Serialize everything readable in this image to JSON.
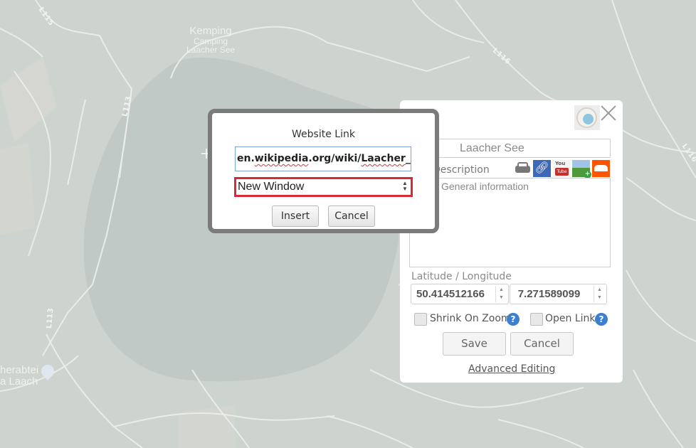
{
  "map": {
    "place_labels": [
      {
        "id": "kemping",
        "lines": [
          "Kemping",
          "Camping",
          "Laacher See"
        ]
      },
      {
        "id": "abbey",
        "lines": [
          "herabtei",
          "a Laach"
        ]
      }
    ],
    "road_labels": [
      "L115",
      "L113",
      "L113",
      "L116",
      "L116"
    ],
    "poi_icon": "building-pin-icon",
    "cursor_icon": "crosshair-icon"
  },
  "marker_panel": {
    "title_value": "Laacher See",
    "description_label": "Description",
    "description_value": "General information",
    "media_icons": [
      "car-icon",
      "link-icon",
      "youtube-icon",
      "image-add-icon",
      "soundcloud-icon"
    ],
    "latlon_label": "Latitude / Longitude",
    "latitude": "50.414512166",
    "longitude": "7.271589099",
    "shrink_on_zoom_label": "Shrink On Zoom",
    "open_link_label": "Open Link",
    "help_glyph": "?",
    "save_label": "Save",
    "cancel_label": "Cancel",
    "advanced_editing_label": "Advanced Editing",
    "close_glyph": "×"
  },
  "link_dialog": {
    "title": "Website Link",
    "url_parts": {
      "plain_1": "en.",
      "misspelled_1": "wikipedia",
      "plain_2": ".org/wiki/",
      "misspelled_2": "Laacher",
      "plain_3": "_See"
    },
    "target_options_selected": "New Window",
    "insert_label": "Insert",
    "cancel_label": "Cancel"
  },
  "colors": {
    "select_highlight": "#d62b35",
    "input_focus": "#7aa5d6",
    "link_icon_bg": "#3d67b8"
  }
}
